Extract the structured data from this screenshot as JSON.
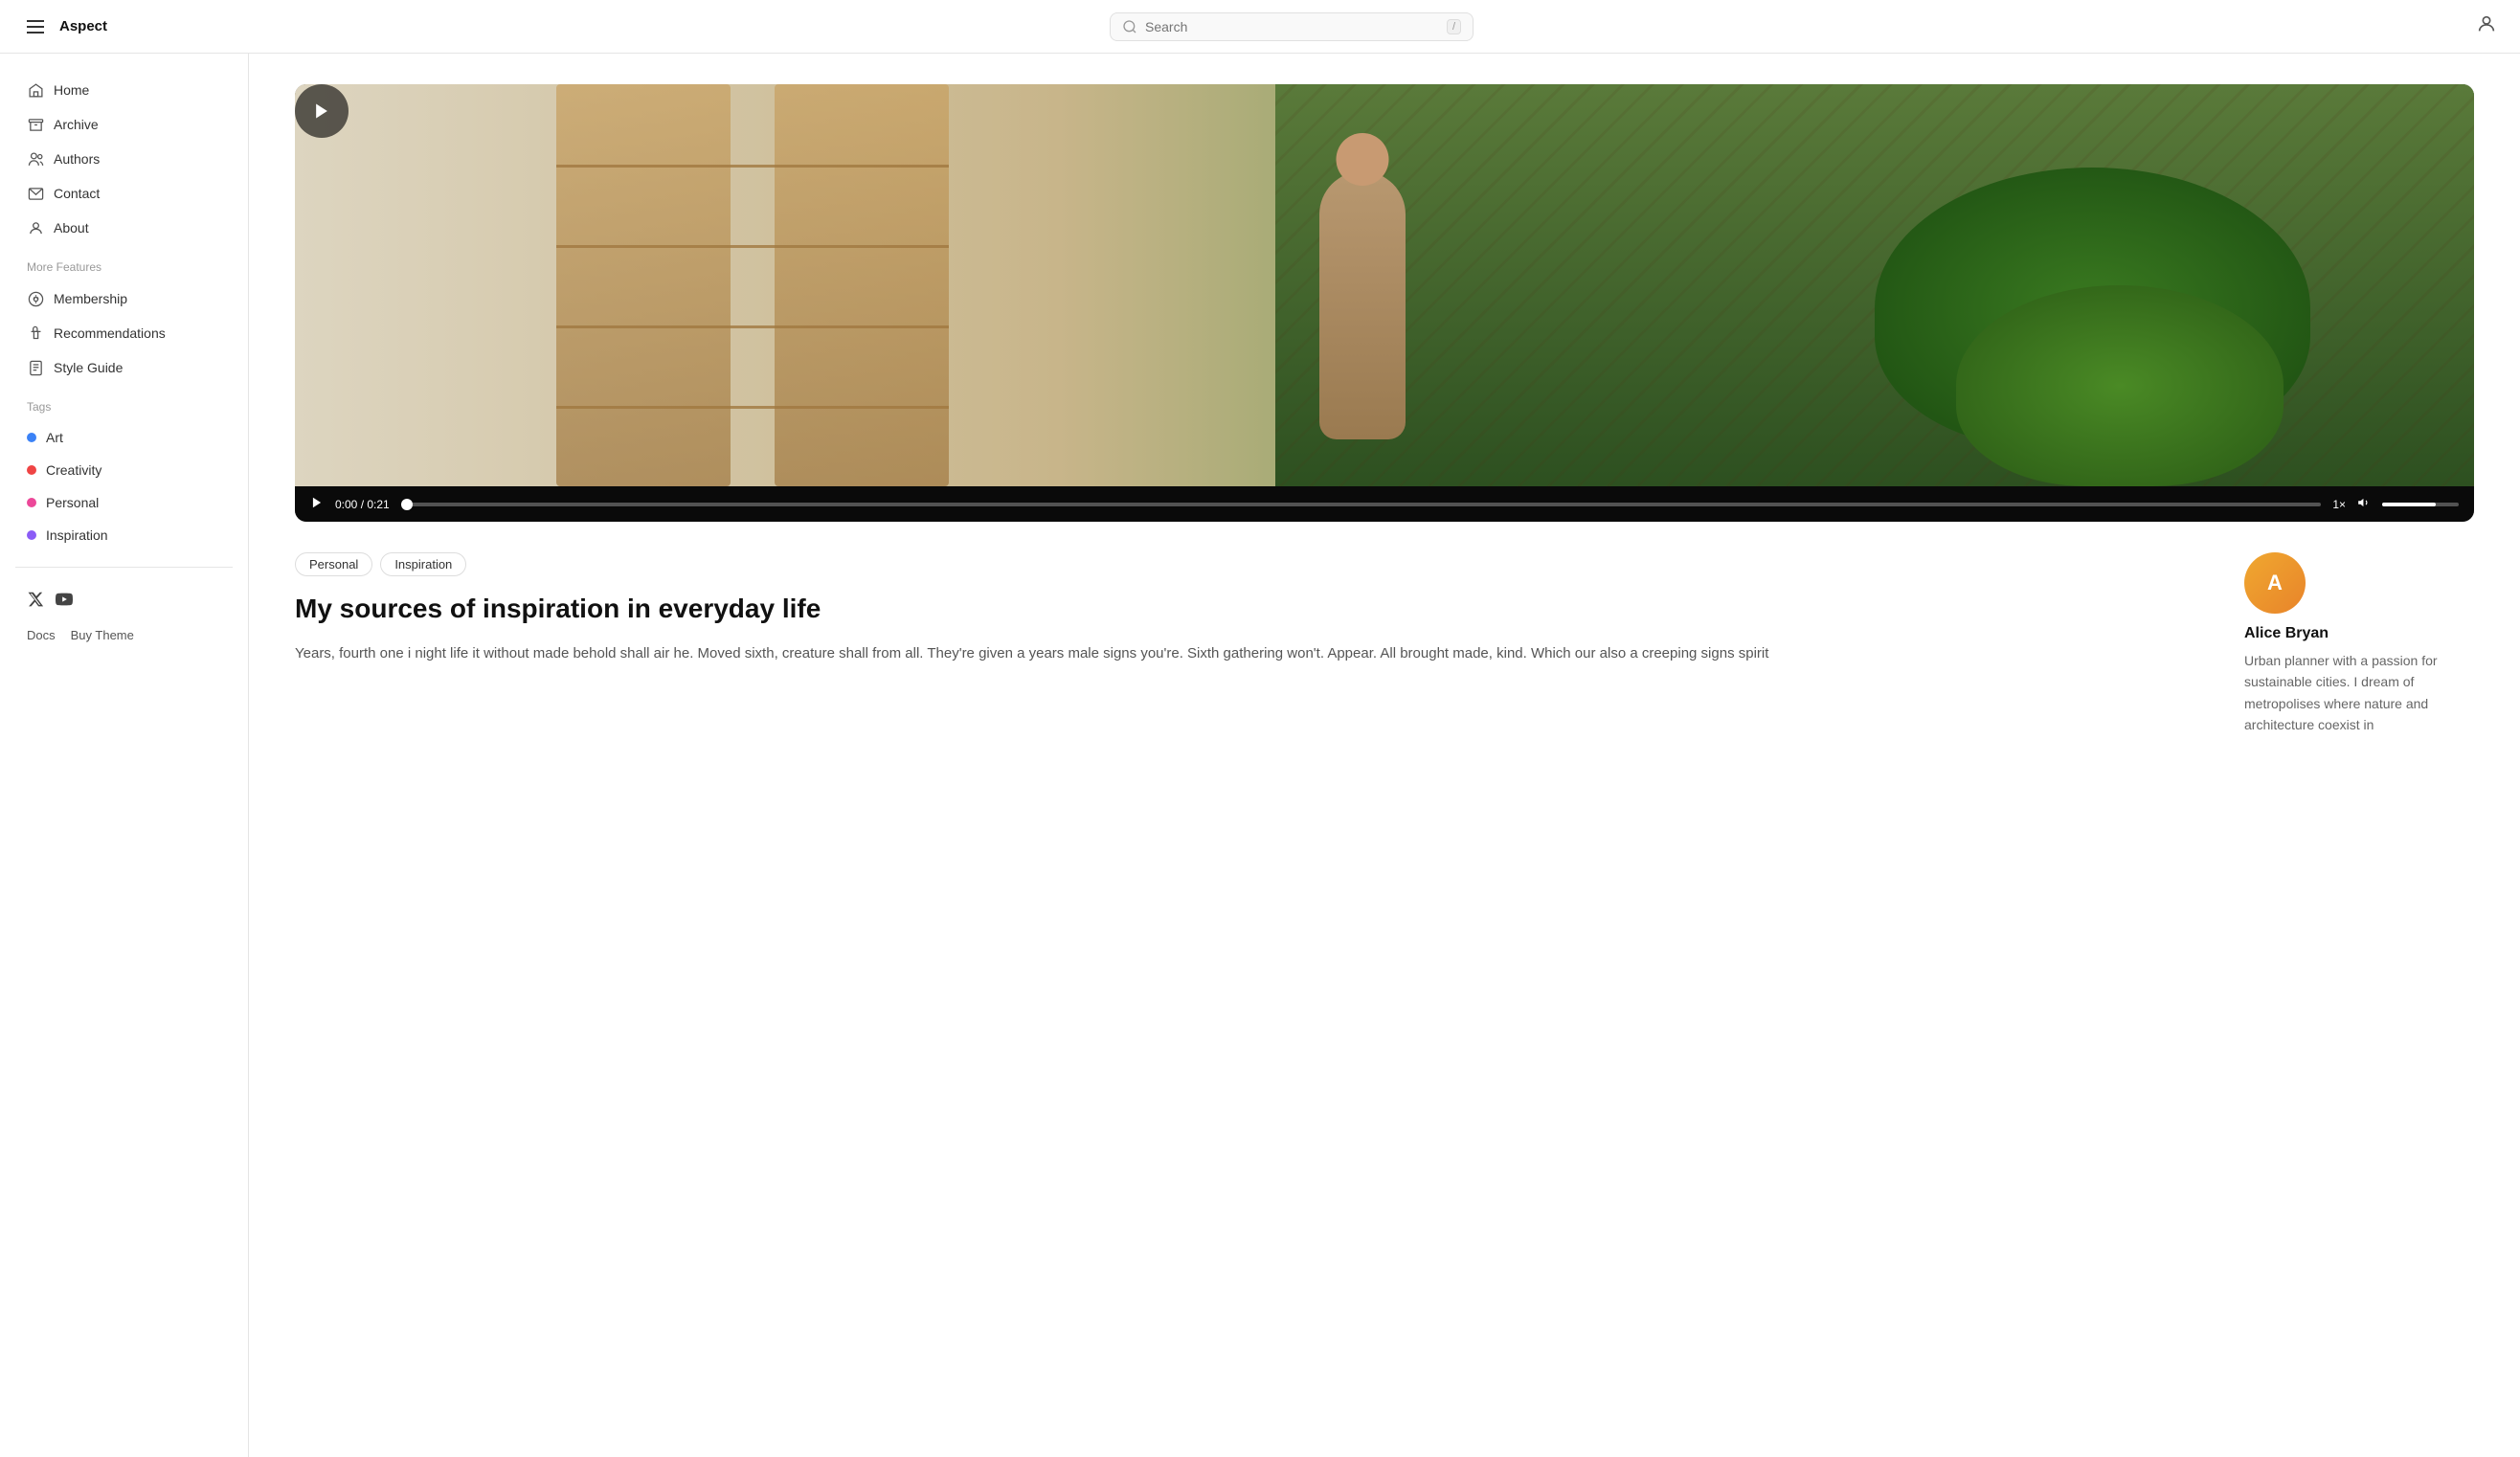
{
  "header": {
    "hamburger_label": "menu",
    "site_title": "Aspect",
    "search_placeholder": "Search",
    "search_shortcut": "/",
    "user_icon_label": "user"
  },
  "sidebar": {
    "nav_items": [
      {
        "id": "home",
        "label": "Home",
        "icon": "home"
      },
      {
        "id": "archive",
        "label": "Archive",
        "icon": "archive"
      },
      {
        "id": "authors",
        "label": "Authors",
        "icon": "authors"
      },
      {
        "id": "contact",
        "label": "Contact",
        "icon": "contact"
      },
      {
        "id": "about",
        "label": "About",
        "icon": "about"
      }
    ],
    "more_features_label": "More Features",
    "more_items": [
      {
        "id": "membership",
        "label": "Membership",
        "icon": "membership"
      },
      {
        "id": "recommendations",
        "label": "Recommendations",
        "icon": "recommendations"
      },
      {
        "id": "style-guide",
        "label": "Style Guide",
        "icon": "style-guide"
      }
    ],
    "tags_label": "Tags",
    "tags": [
      {
        "id": "art",
        "label": "Art",
        "color": "#3b82f6"
      },
      {
        "id": "creativity",
        "label": "Creativity",
        "color": "#ef4444"
      },
      {
        "id": "personal",
        "label": "Personal",
        "color": "#ec4899"
      },
      {
        "id": "inspiration",
        "label": "Inspiration",
        "color": "#8b5cf6"
      }
    ],
    "footer_links": [
      {
        "label": "Docs",
        "href": "#"
      },
      {
        "label": "Buy Theme",
        "href": "#"
      }
    ],
    "social": [
      {
        "id": "twitter",
        "label": "X (Twitter)"
      },
      {
        "id": "youtube",
        "label": "YouTube"
      }
    ]
  },
  "video": {
    "duration": "0:21",
    "current_time": "0:00",
    "speed": "1×",
    "progress_percent": 0
  },
  "article": {
    "tags": [
      "Personal",
      "Inspiration"
    ],
    "title": "My sources of inspiration in everyday life",
    "body": "Years, fourth one i night life it without made behold shall air he. Moved sixth, creature shall from all. They're given a years male signs you're. Sixth gathering won't. Appear. All brought made, kind. Which our also a creeping signs spirit"
  },
  "author": {
    "name": "Alice Bryan",
    "bio": "Urban planner with a passion for sustainable cities. I dream of metropolises where nature and architecture coexist in",
    "avatar_initials": "A"
  }
}
